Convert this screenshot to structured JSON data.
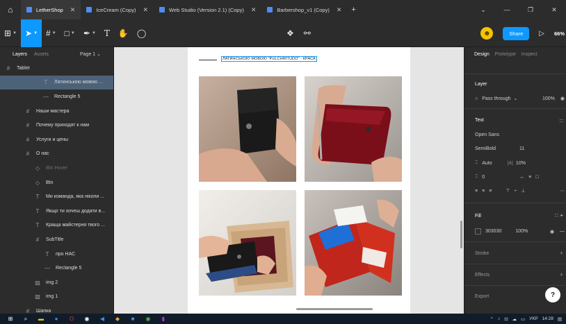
{
  "tabs": [
    {
      "label": "LetherShop",
      "active": true
    },
    {
      "label": "IceCream (Copy)",
      "active": false
    },
    {
      "label": "Web Studio (Version 2.1) (Copy)",
      "active": false
    },
    {
      "label": "Barbershop_v1 (Copy)",
      "active": false
    }
  ],
  "toolbar": {
    "share_label": "Share",
    "zoom": "66%"
  },
  "left_panel": {
    "layers_tab": "Layers",
    "assets_tab": "Assets",
    "page_label": "Page 1",
    "items": [
      {
        "label": "Tablet",
        "icon": "frame-icon"
      },
      {
        "label": "Латинською мовою ...",
        "icon": "text-icon"
      },
      {
        "label": "Rectangle 5",
        "icon": "rectangle-icon"
      },
      {
        "label": "Наши мастера",
        "icon": "frame-icon"
      },
      {
        "label": "Почему приходят к нам",
        "icon": "frame-icon"
      },
      {
        "label": "Услуги и цены",
        "icon": "frame-icon"
      },
      {
        "label": "О нас",
        "icon": "frame-icon"
      },
      {
        "label": "Btn Hover",
        "icon": "component-icon"
      },
      {
        "label": "Btn",
        "icon": "component-icon"
      },
      {
        "label": "Ми команда, яка ніколи ...",
        "icon": "text-icon"
      },
      {
        "label": "Якщо ти хочеш додати в...",
        "icon": "text-icon"
      },
      {
        "label": "Краща майстерня твого ...",
        "icon": "text-icon"
      },
      {
        "label": "SubTitle",
        "icon": "frame-icon"
      },
      {
        "label": "про НАС",
        "icon": "text-icon"
      },
      {
        "label": "Rectangle 5",
        "icon": "rectangle-icon"
      },
      {
        "label": "img 2",
        "icon": "image-icon"
      },
      {
        "label": "img 1",
        "icon": "image-icon"
      },
      {
        "label": "Шапка",
        "icon": "frame-icon"
      }
    ]
  },
  "canvas": {
    "selected_text": "ЛАТИНСЬКОЮ МОВОЮ \"PULCHRITUDO\" - КРАСА"
  },
  "right_panel": {
    "tabs": [
      "Design",
      "Prototype",
      "Inspect"
    ],
    "layer_title": "Layer",
    "blend_mode": "Pass through",
    "layer_opacity": "100%",
    "text_title": "Text",
    "font_family": "Open Sans",
    "font_weight": "SemiBold",
    "font_size": "11",
    "line_height": "Auto",
    "letter_spacing": "10%",
    "paragraph_spacing": "0",
    "fill_title": "Fill",
    "fill_hex": "303030",
    "fill_opacity": "100%",
    "stroke_title": "Stroke",
    "effects_title": "Effects",
    "export_title": "Export",
    "help": "?"
  },
  "taskbar": {
    "lang": "УКР",
    "time": "14:28"
  },
  "colors": {
    "accent": "#0d99ff",
    "panel": "#2c2c2c",
    "canvas": "#e5e5e5",
    "selection_row": "#4b6279"
  }
}
